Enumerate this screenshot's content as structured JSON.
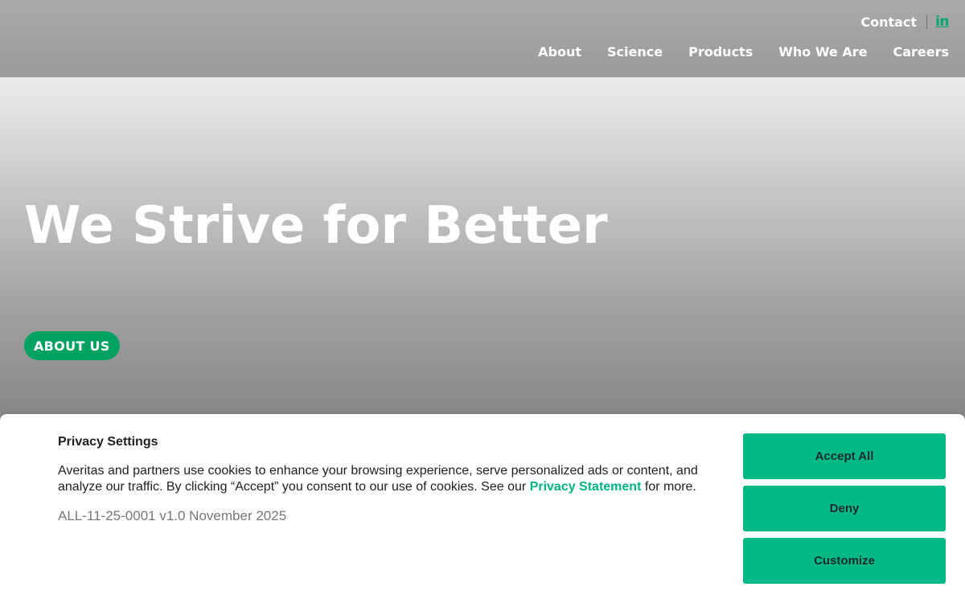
{
  "header": {
    "top_links": {
      "contact_label": "Contact",
      "social_icon": "linkedin-icon",
      "social_text": "in"
    },
    "nav": [
      {
        "label": "About"
      },
      {
        "label": "Science"
      },
      {
        "label": "Products"
      },
      {
        "label": "Who We Are"
      },
      {
        "label": "Careers"
      }
    ]
  },
  "hero": {
    "title": "We Strive for Better",
    "cta_label": "ABOUT US"
  },
  "cookie_banner": {
    "title": "Privacy Settings",
    "text_before_link": "Averitas and partners use cookies to enhance your browsing experience, serve personalized ads or content, and analyze our traffic. By clicking “Accept” you consent to our use of cookies. See our ",
    "link_label": "Privacy Statement",
    "text_after_link": " for more.",
    "version": "ALL-11-25-0001 v1.0 November 2025",
    "buttons": {
      "accept_all": "Accept All",
      "deny": "Deny",
      "customize": "Customize"
    }
  },
  "colors": {
    "brand_green": "#00a261",
    "cookie_button_green": "#00b987",
    "link_green": "#00b581"
  }
}
